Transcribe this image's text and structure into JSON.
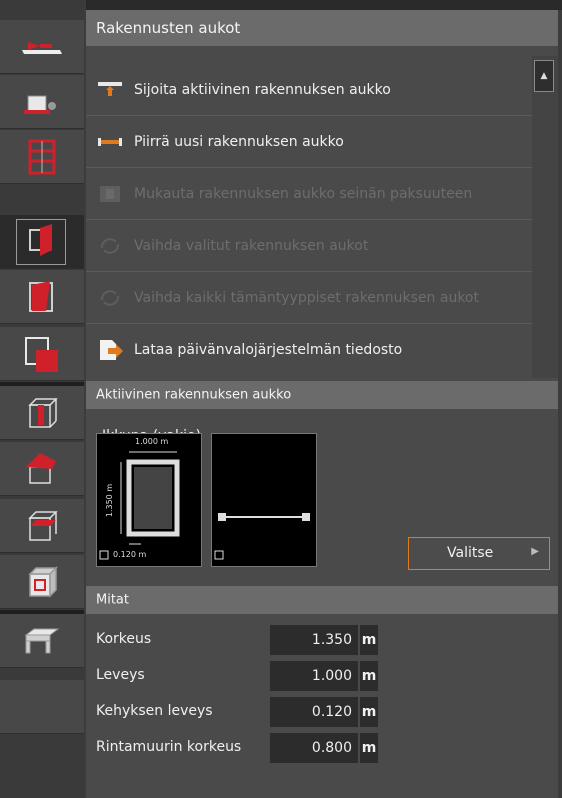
{
  "panel": {
    "title": "Rakennusten aukot",
    "menu": [
      {
        "label": "Sijoita aktiivinen rakennuksen aukko",
        "enabled": true,
        "icon": "place-opening-icon"
      },
      {
        "label": "Piirrä uusi rakennuksen aukko",
        "enabled": true,
        "icon": "draw-opening-icon"
      },
      {
        "label": "Mukauta rakennuksen aukko seinän paksuuteen",
        "enabled": false,
        "icon": "fit-wall-thickness-icon"
      },
      {
        "label": "Vaihda valitut rakennuksen aukot",
        "enabled": false,
        "icon": "replace-selected-icon"
      },
      {
        "label": "Vaihda kaikki tämäntyyppiset rakennuksen aukot",
        "enabled": false,
        "icon": "replace-all-icon"
      },
      {
        "label": "Lataa päivänvalojärjestelmän tiedosto",
        "enabled": true,
        "icon": "load-file-icon"
      }
    ]
  },
  "active_opening": {
    "header": "Aktiivinen rakennuksen aukko",
    "name": "Ikkuna (vakio)",
    "front_width": "1.000 m",
    "front_height": "1.350 m",
    "frame_width": "0.120 m",
    "select_label": "Valitse"
  },
  "dimensions": {
    "header": "Mitat",
    "rows": [
      {
        "label": "Korkeus",
        "value": "1.350",
        "unit": "m"
      },
      {
        "label": "Leveys",
        "value": "1.000",
        "unit": "m"
      },
      {
        "label": "Kehyksen leveys",
        "value": "0.120",
        "unit": "m"
      },
      {
        "label": "Rintamuurin korkeus",
        "value": "0.800",
        "unit": "m"
      }
    ]
  },
  "toolbar": {
    "tools": [
      "opening-arrow-icon",
      "place-object-icon",
      "stair-grid-icon",
      "opening-red-icon",
      "door-panel-icon",
      "overlap-opening-icon",
      "cube-column-icon",
      "cube-roof-icon",
      "cube-slab-icon",
      "cube-window-icon",
      "beam-icon"
    ],
    "active_index": 3
  },
  "colors": {
    "accent": "#e07a1f",
    "red": "#d0202a",
    "header": "#6b6b6b",
    "panel": "#4a4a4a"
  }
}
